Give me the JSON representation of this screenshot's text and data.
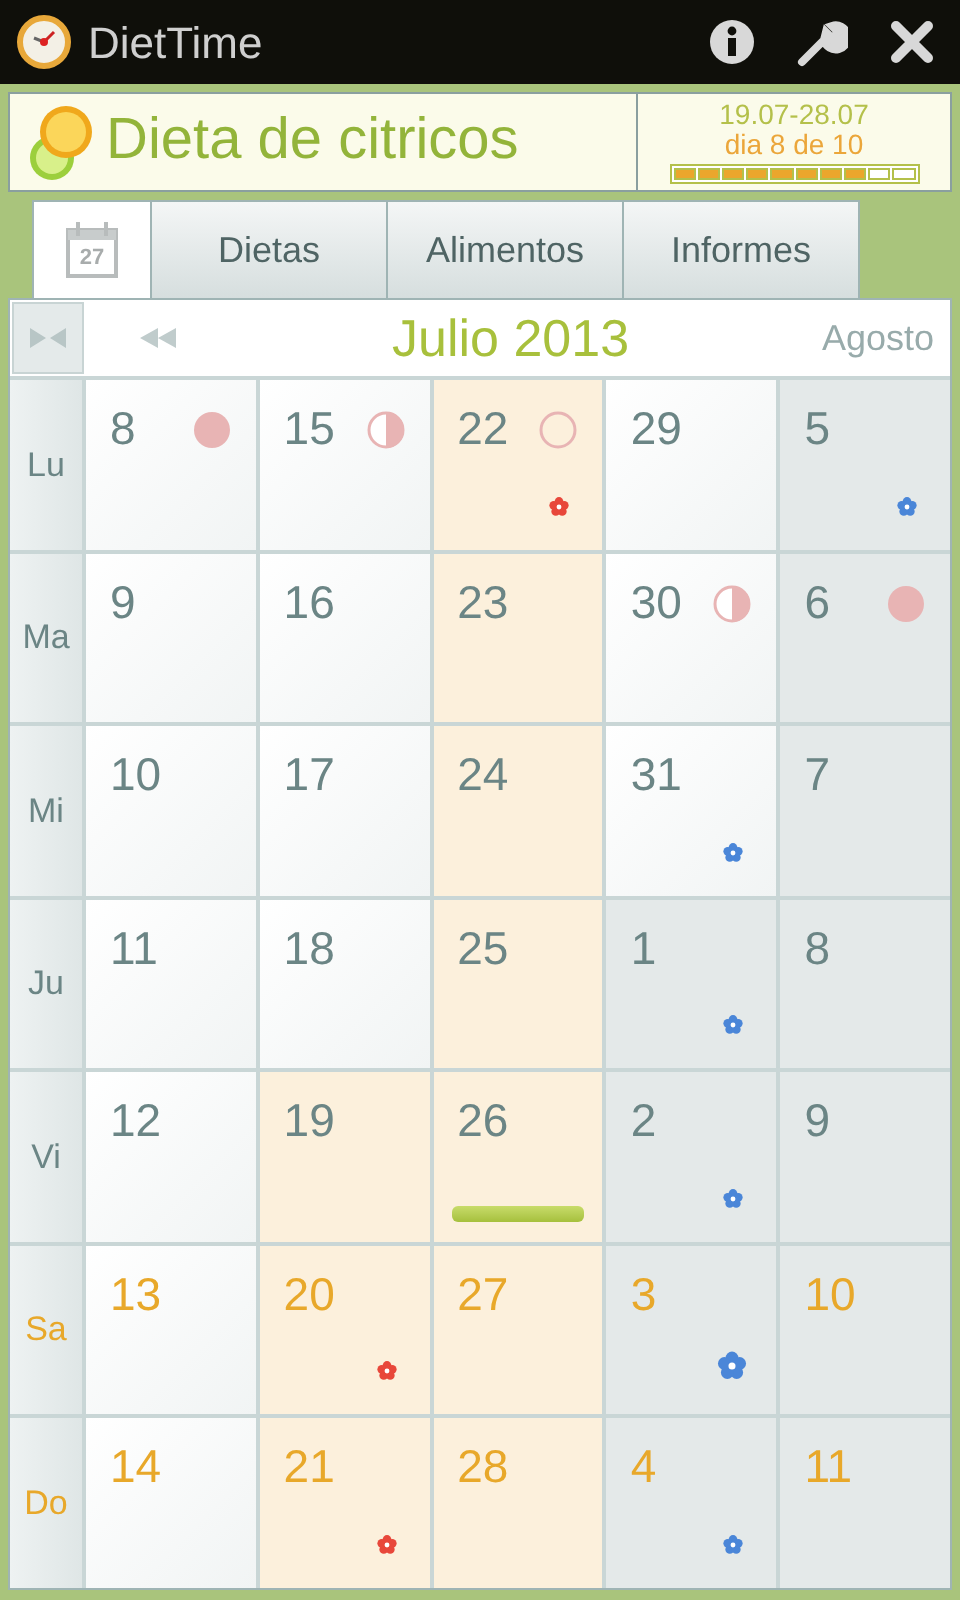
{
  "app_bar": {
    "title": "DietTime"
  },
  "diet": {
    "name": "Dieta de citricos",
    "range": "19.07-28.07",
    "progress_text": "dia 8 de 10",
    "level": 0.8
  },
  "tabs": [
    {
      "kind": "calendar",
      "label": "27",
      "selected": true
    },
    {
      "kind": "text",
      "label": "Dietas",
      "selected": false
    },
    {
      "kind": "text",
      "label": "Alimentos",
      "selected": false
    },
    {
      "kind": "text",
      "label": "Informes",
      "selected": false
    }
  ],
  "calendar": {
    "month": "Julio 2013",
    "next_month": "Agosto",
    "weekdays": [
      {
        "label": "Lu",
        "weekend": false
      },
      {
        "label": "Ma",
        "weekend": false
      },
      {
        "label": "Mi",
        "weekend": false
      },
      {
        "label": "Ju",
        "weekend": false
      },
      {
        "label": "Vi",
        "weekend": false
      },
      {
        "label": "Sa",
        "weekend": true
      },
      {
        "label": "Do",
        "weekend": true
      }
    ],
    "weeks": [
      {
        "days": [
          {
            "day": "8",
            "other_month": false,
            "diet": false,
            "marks": [
              {
                "kind": "moon_full"
              }
            ]
          },
          {
            "day": "9",
            "other_month": false,
            "diet": false
          },
          {
            "day": "10",
            "other_month": false,
            "diet": false
          },
          {
            "day": "11",
            "other_month": false,
            "diet": false
          },
          {
            "day": "12",
            "other_month": false,
            "diet": false
          },
          {
            "day": "13",
            "other_month": false,
            "diet": false
          },
          {
            "day": "14",
            "other_month": false,
            "diet": false
          }
        ]
      },
      {
        "days": [
          {
            "day": "15",
            "other_month": false,
            "diet": false,
            "marks": [
              {
                "kind": "moon_half"
              }
            ]
          },
          {
            "day": "16",
            "other_month": false,
            "diet": false
          },
          {
            "day": "17",
            "other_month": false,
            "diet": false
          },
          {
            "day": "18",
            "other_month": false,
            "diet": false
          },
          {
            "day": "19",
            "other_month": false,
            "diet": true
          },
          {
            "day": "20",
            "other_month": false,
            "diet": true,
            "marks": [
              {
                "kind": "flower_red"
              }
            ]
          },
          {
            "day": "21",
            "other_month": false,
            "diet": true,
            "marks": [
              {
                "kind": "flower_red"
              }
            ]
          }
        ]
      },
      {
        "days": [
          {
            "day": "22",
            "other_month": false,
            "diet": true,
            "marks": [
              {
                "kind": "moon_new"
              },
              {
                "kind": "flower_red"
              }
            ]
          },
          {
            "day": "23",
            "other_month": false,
            "diet": true
          },
          {
            "day": "24",
            "other_month": false,
            "diet": true
          },
          {
            "day": "25",
            "other_month": false,
            "diet": true
          },
          {
            "day": "26",
            "other_month": false,
            "diet": true,
            "today": true
          },
          {
            "day": "27",
            "other_month": false,
            "diet": true
          },
          {
            "day": "28",
            "other_month": false,
            "diet": true
          }
        ]
      },
      {
        "days": [
          {
            "day": "29",
            "other_month": false,
            "diet": false
          },
          {
            "day": "30",
            "other_month": false,
            "diet": false,
            "marks": [
              {
                "kind": "moon_half"
              }
            ]
          },
          {
            "day": "31",
            "other_month": false,
            "diet": false,
            "marks": [
              {
                "kind": "flower_blue"
              }
            ]
          },
          {
            "day": "1",
            "other_month": true,
            "diet": false,
            "marks": [
              {
                "kind": "flower_blue"
              }
            ]
          },
          {
            "day": "2",
            "other_month": true,
            "diet": false,
            "marks": [
              {
                "kind": "flower_blue"
              }
            ]
          },
          {
            "day": "3",
            "other_month": true,
            "diet": false,
            "marks": [
              {
                "kind": "flower_blue_large"
              }
            ]
          },
          {
            "day": "4",
            "other_month": true,
            "diet": false,
            "marks": [
              {
                "kind": "flower_blue"
              }
            ]
          }
        ]
      },
      {
        "days": [
          {
            "day": "5",
            "other_month": true,
            "diet": false,
            "marks": [
              {
                "kind": "flower_blue"
              }
            ]
          },
          {
            "day": "6",
            "other_month": true,
            "diet": false,
            "marks": [
              {
                "kind": "moon_full"
              }
            ]
          },
          {
            "day": "7",
            "other_month": true,
            "diet": false
          },
          {
            "day": "8",
            "other_month": true,
            "diet": false
          },
          {
            "day": "9",
            "other_month": true,
            "diet": false
          },
          {
            "day": "10",
            "other_month": true,
            "diet": false
          },
          {
            "day": "11",
            "other_month": true,
            "diet": false
          }
        ]
      }
    ]
  }
}
